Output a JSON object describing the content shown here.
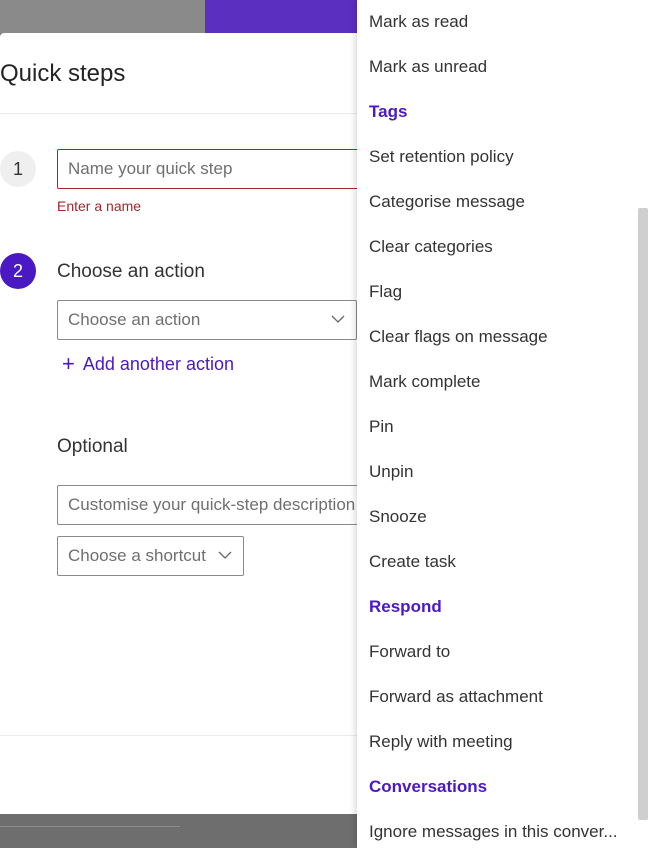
{
  "dialog": {
    "title": "Quick steps",
    "step1_number": "1",
    "name_placeholder": "Name your quick step",
    "name_error": "Enter a name",
    "step2_number": "2",
    "choose_action_label": "Choose an action",
    "action_select_placeholder": "Choose an action",
    "add_action_label": "Add another action",
    "optional_label": "Optional",
    "description_placeholder": "Customise your quick-step description",
    "shortcut_placeholder": "Choose a shortcut"
  },
  "menu": {
    "items": [
      {
        "label": "Mark as read",
        "type": "item"
      },
      {
        "label": "Mark as unread",
        "type": "item"
      },
      {
        "label": "Tags",
        "type": "header"
      },
      {
        "label": "Set retention policy",
        "type": "item"
      },
      {
        "label": "Categorise message",
        "type": "item"
      },
      {
        "label": "Clear categories",
        "type": "item"
      },
      {
        "label": "Flag",
        "type": "item"
      },
      {
        "label": "Clear flags on message",
        "type": "item"
      },
      {
        "label": "Mark complete",
        "type": "item"
      },
      {
        "label": "Pin",
        "type": "item"
      },
      {
        "label": "Unpin",
        "type": "item"
      },
      {
        "label": "Snooze",
        "type": "item"
      },
      {
        "label": "Create task",
        "type": "item"
      },
      {
        "label": "Respond",
        "type": "header"
      },
      {
        "label": "Forward to",
        "type": "item"
      },
      {
        "label": "Forward as attachment",
        "type": "item"
      },
      {
        "label": "Reply with meeting",
        "type": "item"
      },
      {
        "label": "Conversations",
        "type": "header"
      },
      {
        "label": "Ignore messages in this conver...",
        "type": "item"
      }
    ]
  },
  "colors": {
    "accent": "#4b19c4",
    "error": "#a4262c"
  }
}
